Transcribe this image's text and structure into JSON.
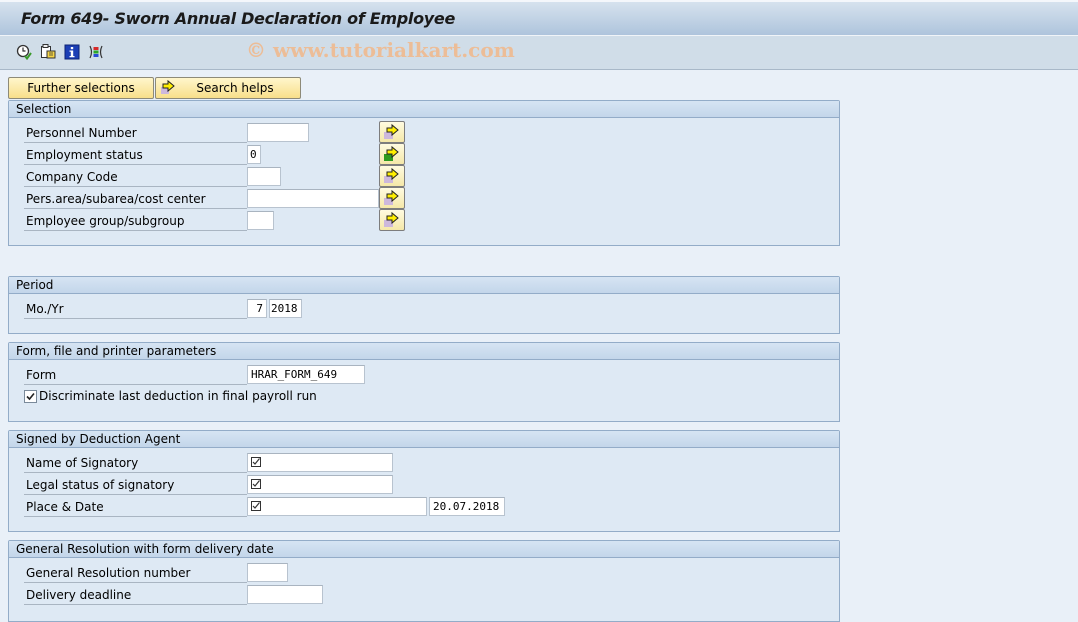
{
  "window": {
    "title": "Form 649- Sworn Annual Declaration of Employee",
    "watermark": "© www.tutorialkart.com"
  },
  "toolbar": {
    "icons": [
      {
        "name": "execute-in-background-icon"
      },
      {
        "name": "get-variant-icon"
      },
      {
        "name": "program-documentation-icon"
      },
      {
        "name": "selection-options-icon"
      }
    ]
  },
  "buttons": {
    "further_selections": "Further selections",
    "search_helps": "Search helps"
  },
  "sections": {
    "selection": {
      "title": "Selection",
      "fields": [
        {
          "label": "Personnel Number",
          "value": ""
        },
        {
          "label": "Employment status",
          "value": "0"
        },
        {
          "label": "Company Code",
          "value": ""
        },
        {
          "label": "Pers.area/subarea/cost center",
          "value": ""
        },
        {
          "label": "Employee group/subgroup",
          "value": ""
        }
      ]
    },
    "period": {
      "title": "Period",
      "fields": [
        {
          "label": "Mo./Yr",
          "month": "7",
          "year": "2018"
        }
      ]
    },
    "form_params": {
      "title": "Form, file and printer parameters",
      "form_label": "Form",
      "form_value": "HRAR_FORM_649",
      "checkbox_label": "Discriminate last deduction in final payroll run",
      "checkbox_checked": true
    },
    "signed": {
      "title": "Signed by Deduction Agent",
      "fields": [
        {
          "label": "Name of Signatory",
          "value": ""
        },
        {
          "label": "Legal status of signatory",
          "value": ""
        },
        {
          "label": "Place & Date",
          "value": "",
          "date": "20.07.2018"
        }
      ]
    },
    "resolution": {
      "title": "General Resolution with form delivery date",
      "fields": [
        {
          "label": "General Resolution number",
          "value": ""
        },
        {
          "label": "Delivery deadline",
          "value": ""
        }
      ]
    }
  }
}
